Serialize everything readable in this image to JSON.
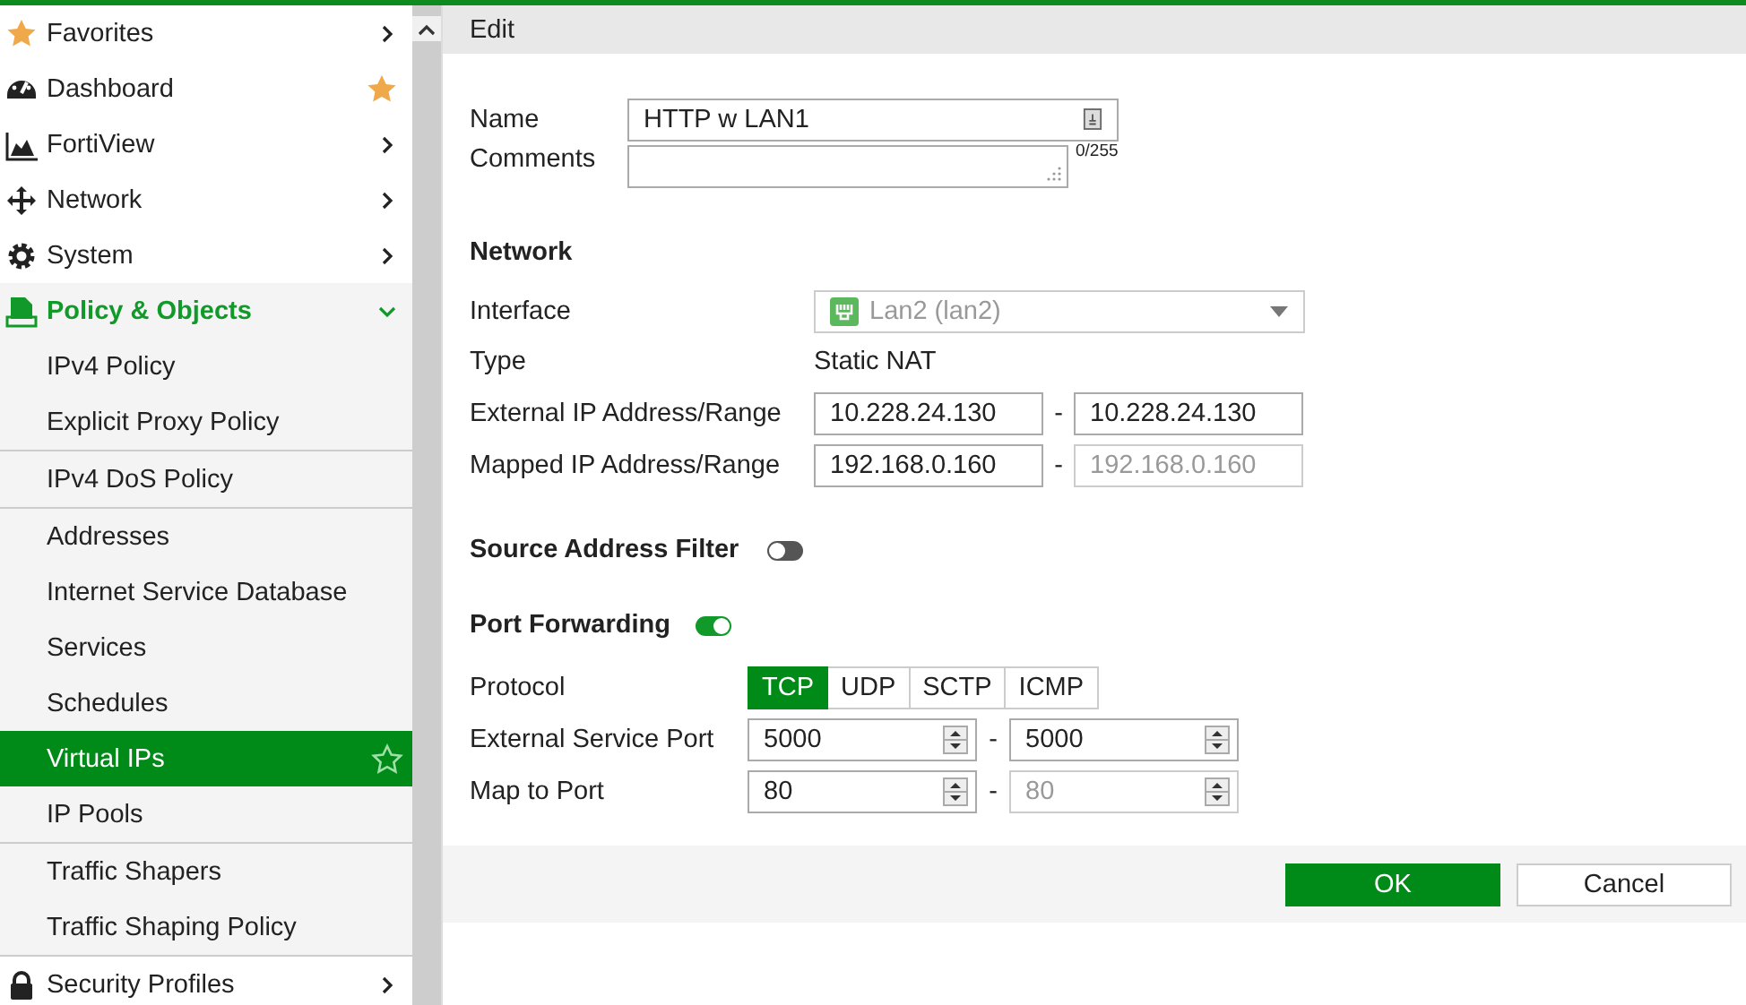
{
  "sidebar": {
    "items": [
      {
        "label": "Favorites",
        "kind": "group",
        "expanded": false
      },
      {
        "label": "Dashboard",
        "kind": "page",
        "favorite": true
      },
      {
        "label": "FortiView",
        "kind": "group",
        "expanded": false
      },
      {
        "label": "Network",
        "kind": "group",
        "expanded": false
      },
      {
        "label": "System",
        "kind": "group",
        "expanded": false
      },
      {
        "label": "Policy & Objects",
        "kind": "group",
        "expanded": true,
        "sections": [
          [
            {
              "label": "IPv4 Policy",
              "selected": false
            },
            {
              "label": "Explicit Proxy Policy",
              "selected": false
            }
          ],
          [
            {
              "label": "IPv4 DoS Policy",
              "selected": false
            }
          ],
          [
            {
              "label": "Addresses",
              "selected": false
            },
            {
              "label": "Internet Service Database",
              "selected": false
            },
            {
              "label": "Services",
              "selected": false
            },
            {
              "label": "Schedules",
              "selected": false
            },
            {
              "label": "Virtual IPs",
              "selected": true
            },
            {
              "label": "IP Pools",
              "selected": false
            }
          ],
          [
            {
              "label": "Traffic Shapers",
              "selected": false
            },
            {
              "label": "Traffic Shaping Policy",
              "selected": false
            }
          ]
        ]
      },
      {
        "label": "Security Profiles",
        "kind": "group",
        "expanded": false
      }
    ]
  },
  "panel": {
    "title": "Edit",
    "name": {
      "label": "Name",
      "value": "HTTP w LAN1"
    },
    "comments": {
      "label": "Comments",
      "counter": "0/255"
    },
    "network": {
      "heading": "Network",
      "interface": {
        "label": "Interface",
        "value": "Lan2 (lan2)",
        "disabled": true
      },
      "type": {
        "label": "Type",
        "value": "Static NAT"
      },
      "ranges": [
        {
          "label": "External IP Address/Range",
          "from": "10.228.24.130",
          "separator": "-",
          "to": "10.228.24.130",
          "to_disabled": false
        },
        {
          "label": "Mapped IP Address/Range",
          "from": "192.168.0.160",
          "separator": "-",
          "to": "192.168.0.160",
          "to_disabled": true
        }
      ]
    },
    "source_address_filter": {
      "label": "Source Address Filter",
      "on": false
    },
    "port_forwarding": {
      "label": "Port Forwarding",
      "on": true,
      "protocol": {
        "label": "Protocol",
        "options": [
          {
            "label": "TCP",
            "selected": true
          },
          {
            "label": "UDP",
            "selected": false
          },
          {
            "label": "SCTP",
            "selected": false
          },
          {
            "label": "ICMP",
            "selected": false
          }
        ]
      },
      "ports": [
        {
          "label": "External Service Port",
          "from": "5000",
          "separator": "-",
          "to": "5000",
          "to_disabled": false
        },
        {
          "label": "Map to Port",
          "from": "80",
          "separator": "-",
          "to": "80",
          "to_disabled": true
        }
      ]
    }
  },
  "buttons": [
    {
      "label": "OK",
      "kind": "primary"
    },
    {
      "label": "Cancel",
      "kind": "secondary"
    }
  ]
}
